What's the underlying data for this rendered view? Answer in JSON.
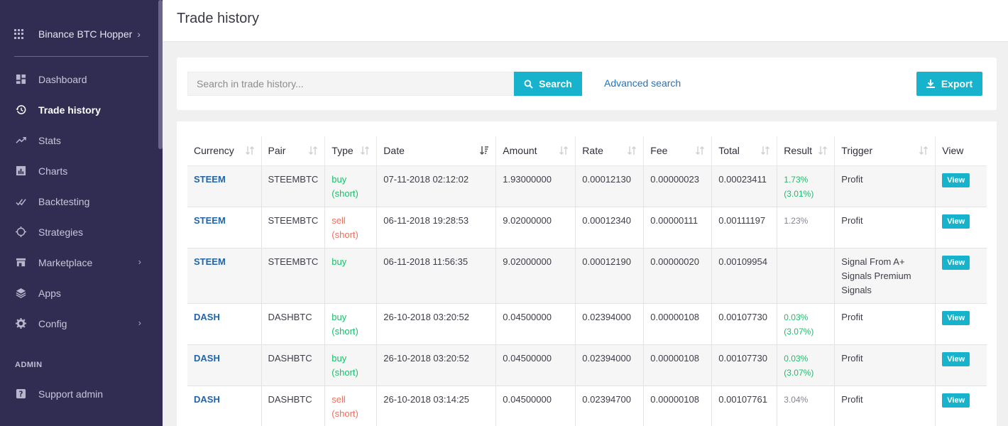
{
  "sidebar": {
    "app_name": "Binance BTC Hopper",
    "items": [
      {
        "label": "Dashboard",
        "icon": "dashboard-icon"
      },
      {
        "label": "Trade history",
        "icon": "history-icon",
        "active": true
      },
      {
        "label": "Stats",
        "icon": "trending-up-icon"
      },
      {
        "label": "Charts",
        "icon": "chart-icon"
      },
      {
        "label": "Backtesting",
        "icon": "checkmarks-icon"
      },
      {
        "label": "Strategies",
        "icon": "crosshair-icon"
      },
      {
        "label": "Marketplace",
        "icon": "store-icon",
        "has_children": true
      },
      {
        "label": "Apps",
        "icon": "layers-icon"
      },
      {
        "label": "Config",
        "icon": "gear-icon",
        "has_children": true
      }
    ],
    "admin_label": "ADMIN",
    "support_label": "Support admin"
  },
  "header": {
    "title": "Trade history"
  },
  "search": {
    "placeholder": "Search in trade history...",
    "button_label": "Search",
    "advanced_label": "Advanced search",
    "export_label": "Export"
  },
  "colors": {
    "accent": "#17b3cc",
    "sidebar": "#312c52",
    "buy": "#1cbd6a",
    "sell": "#ef6f5e",
    "link": "#2364a8"
  },
  "table": {
    "columns": [
      "Currency",
      "Pair",
      "Type",
      "Date",
      "Amount",
      "Rate",
      "Fee",
      "Total",
      "Result",
      "Trigger",
      "View"
    ],
    "view_label": "View",
    "rows": [
      {
        "currency": "STEEM",
        "pair": "STEEMBTC",
        "type": "buy",
        "type_note": "(short)",
        "date": "07-11-2018 02:12:02",
        "amount": "1.93000000",
        "rate": "0.00012130",
        "fee": "0.00000023",
        "total": "0.00023411",
        "result": "1.73%",
        "result_note": "(3.01%)",
        "result_style": "pos",
        "trigger": "Profit"
      },
      {
        "currency": "STEEM",
        "pair": "STEEMBTC",
        "type": "sell",
        "type_note": "(short)",
        "date": "06-11-2018 19:28:53",
        "amount": "9.02000000",
        "rate": "0.00012340",
        "fee": "0.00000111",
        "total": "0.00111197",
        "result": "1.23%",
        "result_note": "",
        "result_style": "neutral",
        "trigger": "Profit"
      },
      {
        "currency": "STEEM",
        "pair": "STEEMBTC",
        "type": "buy",
        "type_note": "",
        "date": "06-11-2018 11:56:35",
        "amount": "9.02000000",
        "rate": "0.00012190",
        "fee": "0.00000020",
        "total": "0.00109954",
        "result": "",
        "result_note": "",
        "result_style": "neutral",
        "trigger": "Signal From A+ Signals Premium Signals"
      },
      {
        "currency": "DASH",
        "pair": "DASHBTC",
        "type": "buy",
        "type_note": "(short)",
        "date": "26-10-2018 03:20:52",
        "amount": "0.04500000",
        "rate": "0.02394000",
        "fee": "0.00000108",
        "total": "0.00107730",
        "result": "0.03%",
        "result_note": "(3.07%)",
        "result_style": "pos",
        "trigger": "Profit"
      },
      {
        "currency": "DASH",
        "pair": "DASHBTC",
        "type": "buy",
        "type_note": "(short)",
        "date": "26-10-2018 03:20:52",
        "amount": "0.04500000",
        "rate": "0.02394000",
        "fee": "0.00000108",
        "total": "0.00107730",
        "result": "0.03%",
        "result_note": "(3.07%)",
        "result_style": "pos",
        "trigger": "Profit"
      },
      {
        "currency": "DASH",
        "pair": "DASHBTC",
        "type": "sell",
        "type_note": "(short)",
        "date": "26-10-2018 03:14:25",
        "amount": "0.04500000",
        "rate": "0.02394700",
        "fee": "0.00000108",
        "total": "0.00107761",
        "result": "3.04%",
        "result_note": "",
        "result_style": "neutral",
        "trigger": "Profit"
      }
    ]
  }
}
